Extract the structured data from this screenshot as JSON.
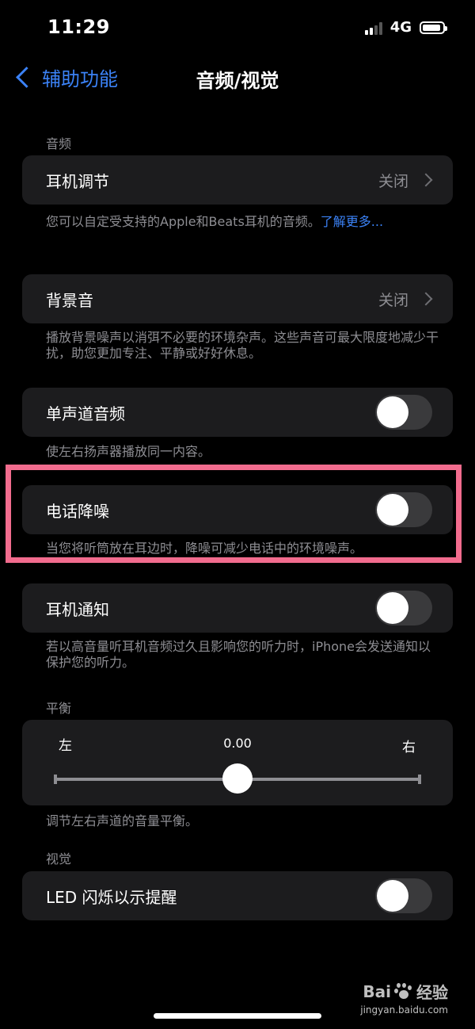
{
  "status": {
    "time": "11:29",
    "network": "4G"
  },
  "nav": {
    "back_label": "辅助功能",
    "title": "音频/视觉"
  },
  "sections": {
    "audio_header": "音频",
    "balance_header": "平衡",
    "visual_header": "视觉"
  },
  "headphone": {
    "label": "耳机调节",
    "value": "关闭",
    "note": "您可以自定受支持的Apple和Beats耳机的音频。",
    "link": "了解更多..."
  },
  "background_sounds": {
    "label": "背景音",
    "value": "关闭",
    "note": "播放背景噪声以消弭不必要的环境杂声。这些声音可最大限度地减少干扰，助您更加专注、平静或好好休息。"
  },
  "mono_audio": {
    "label": "单声道音频",
    "enabled": false,
    "note": "使左右扬声器播放同一内容。"
  },
  "phone_noise": {
    "label": "电话降噪",
    "enabled": false,
    "note": "当您将听筒放在耳边时，降噪可减少电话中的环境噪声。"
  },
  "headphone_notify": {
    "label": "耳机通知",
    "enabled": false,
    "note": "若以高音量听耳机音频过久且影响您的听力时，iPhone会发送通知以保护您的听力。"
  },
  "balance": {
    "left": "左",
    "right": "右",
    "value": "0.00",
    "level": 0.5,
    "note": "调节左右声道的音量平衡。"
  },
  "led_flash": {
    "label": "LED 闪烁以示提醒",
    "enabled": false
  },
  "watermark": {
    "brand": "Bai",
    "brand2": "经验",
    "url": "jingyan.baidu.com"
  },
  "colors": {
    "accent": "#3b82f6",
    "highlight": "#f26c8e",
    "cell_bg": "#1c1c1e"
  }
}
